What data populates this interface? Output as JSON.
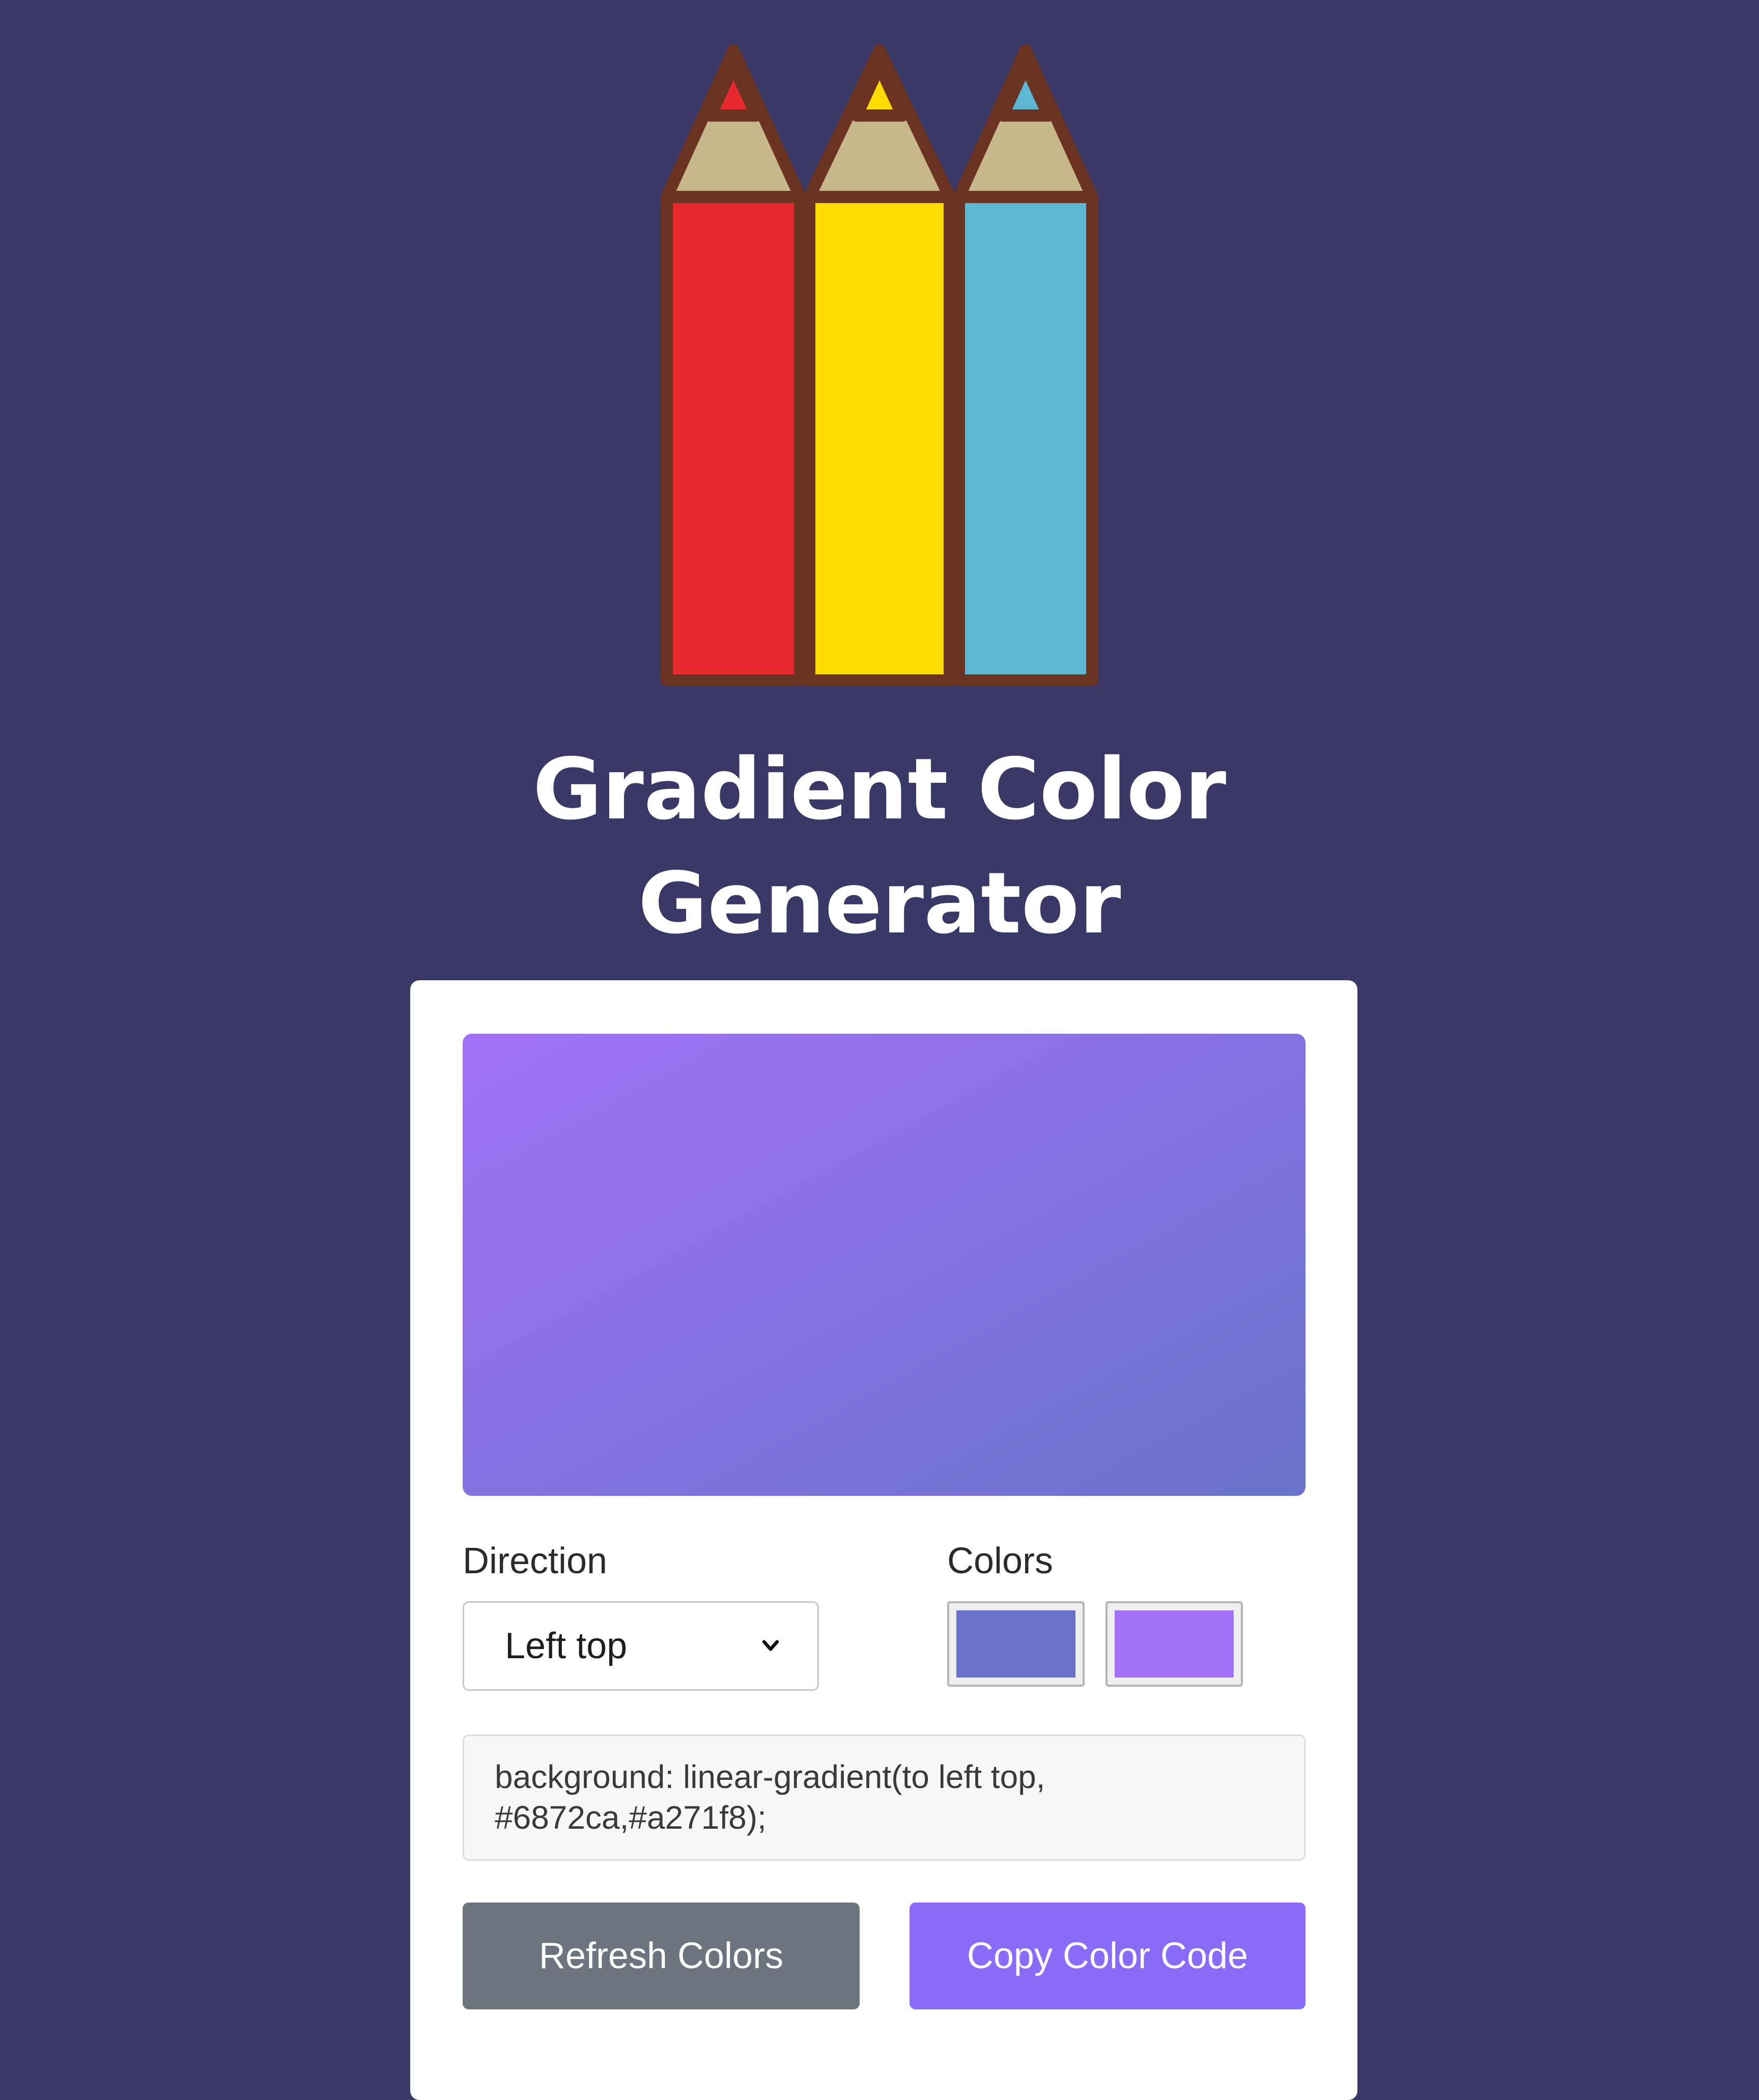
{
  "app": {
    "title_line1": "Gradient Color",
    "title_line2": "Generator"
  },
  "logo": {
    "icon": "colored-pencils-icon",
    "pencil_colors": [
      "#e8292d",
      "#ffdb00",
      "#5db8d6"
    ],
    "outline_color": "#6b3322",
    "wood_color": "#c7b78a"
  },
  "theme": {
    "page_background": "#393866",
    "refresh_button_color": "#6c757d",
    "copy_button_color": "#8a6bfa"
  },
  "generator": {
    "direction_label": "Direction",
    "direction_value": "Left top",
    "direction_css": "to left top",
    "colors_label": "Colors",
    "color_1": "#6872ca",
    "color_2": "#a271f8",
    "code_text": "background: linear-gradient(to left top, #6872ca,#a271f8);",
    "refresh_label": "Refresh Colors",
    "copy_label": "Copy Color Code"
  }
}
